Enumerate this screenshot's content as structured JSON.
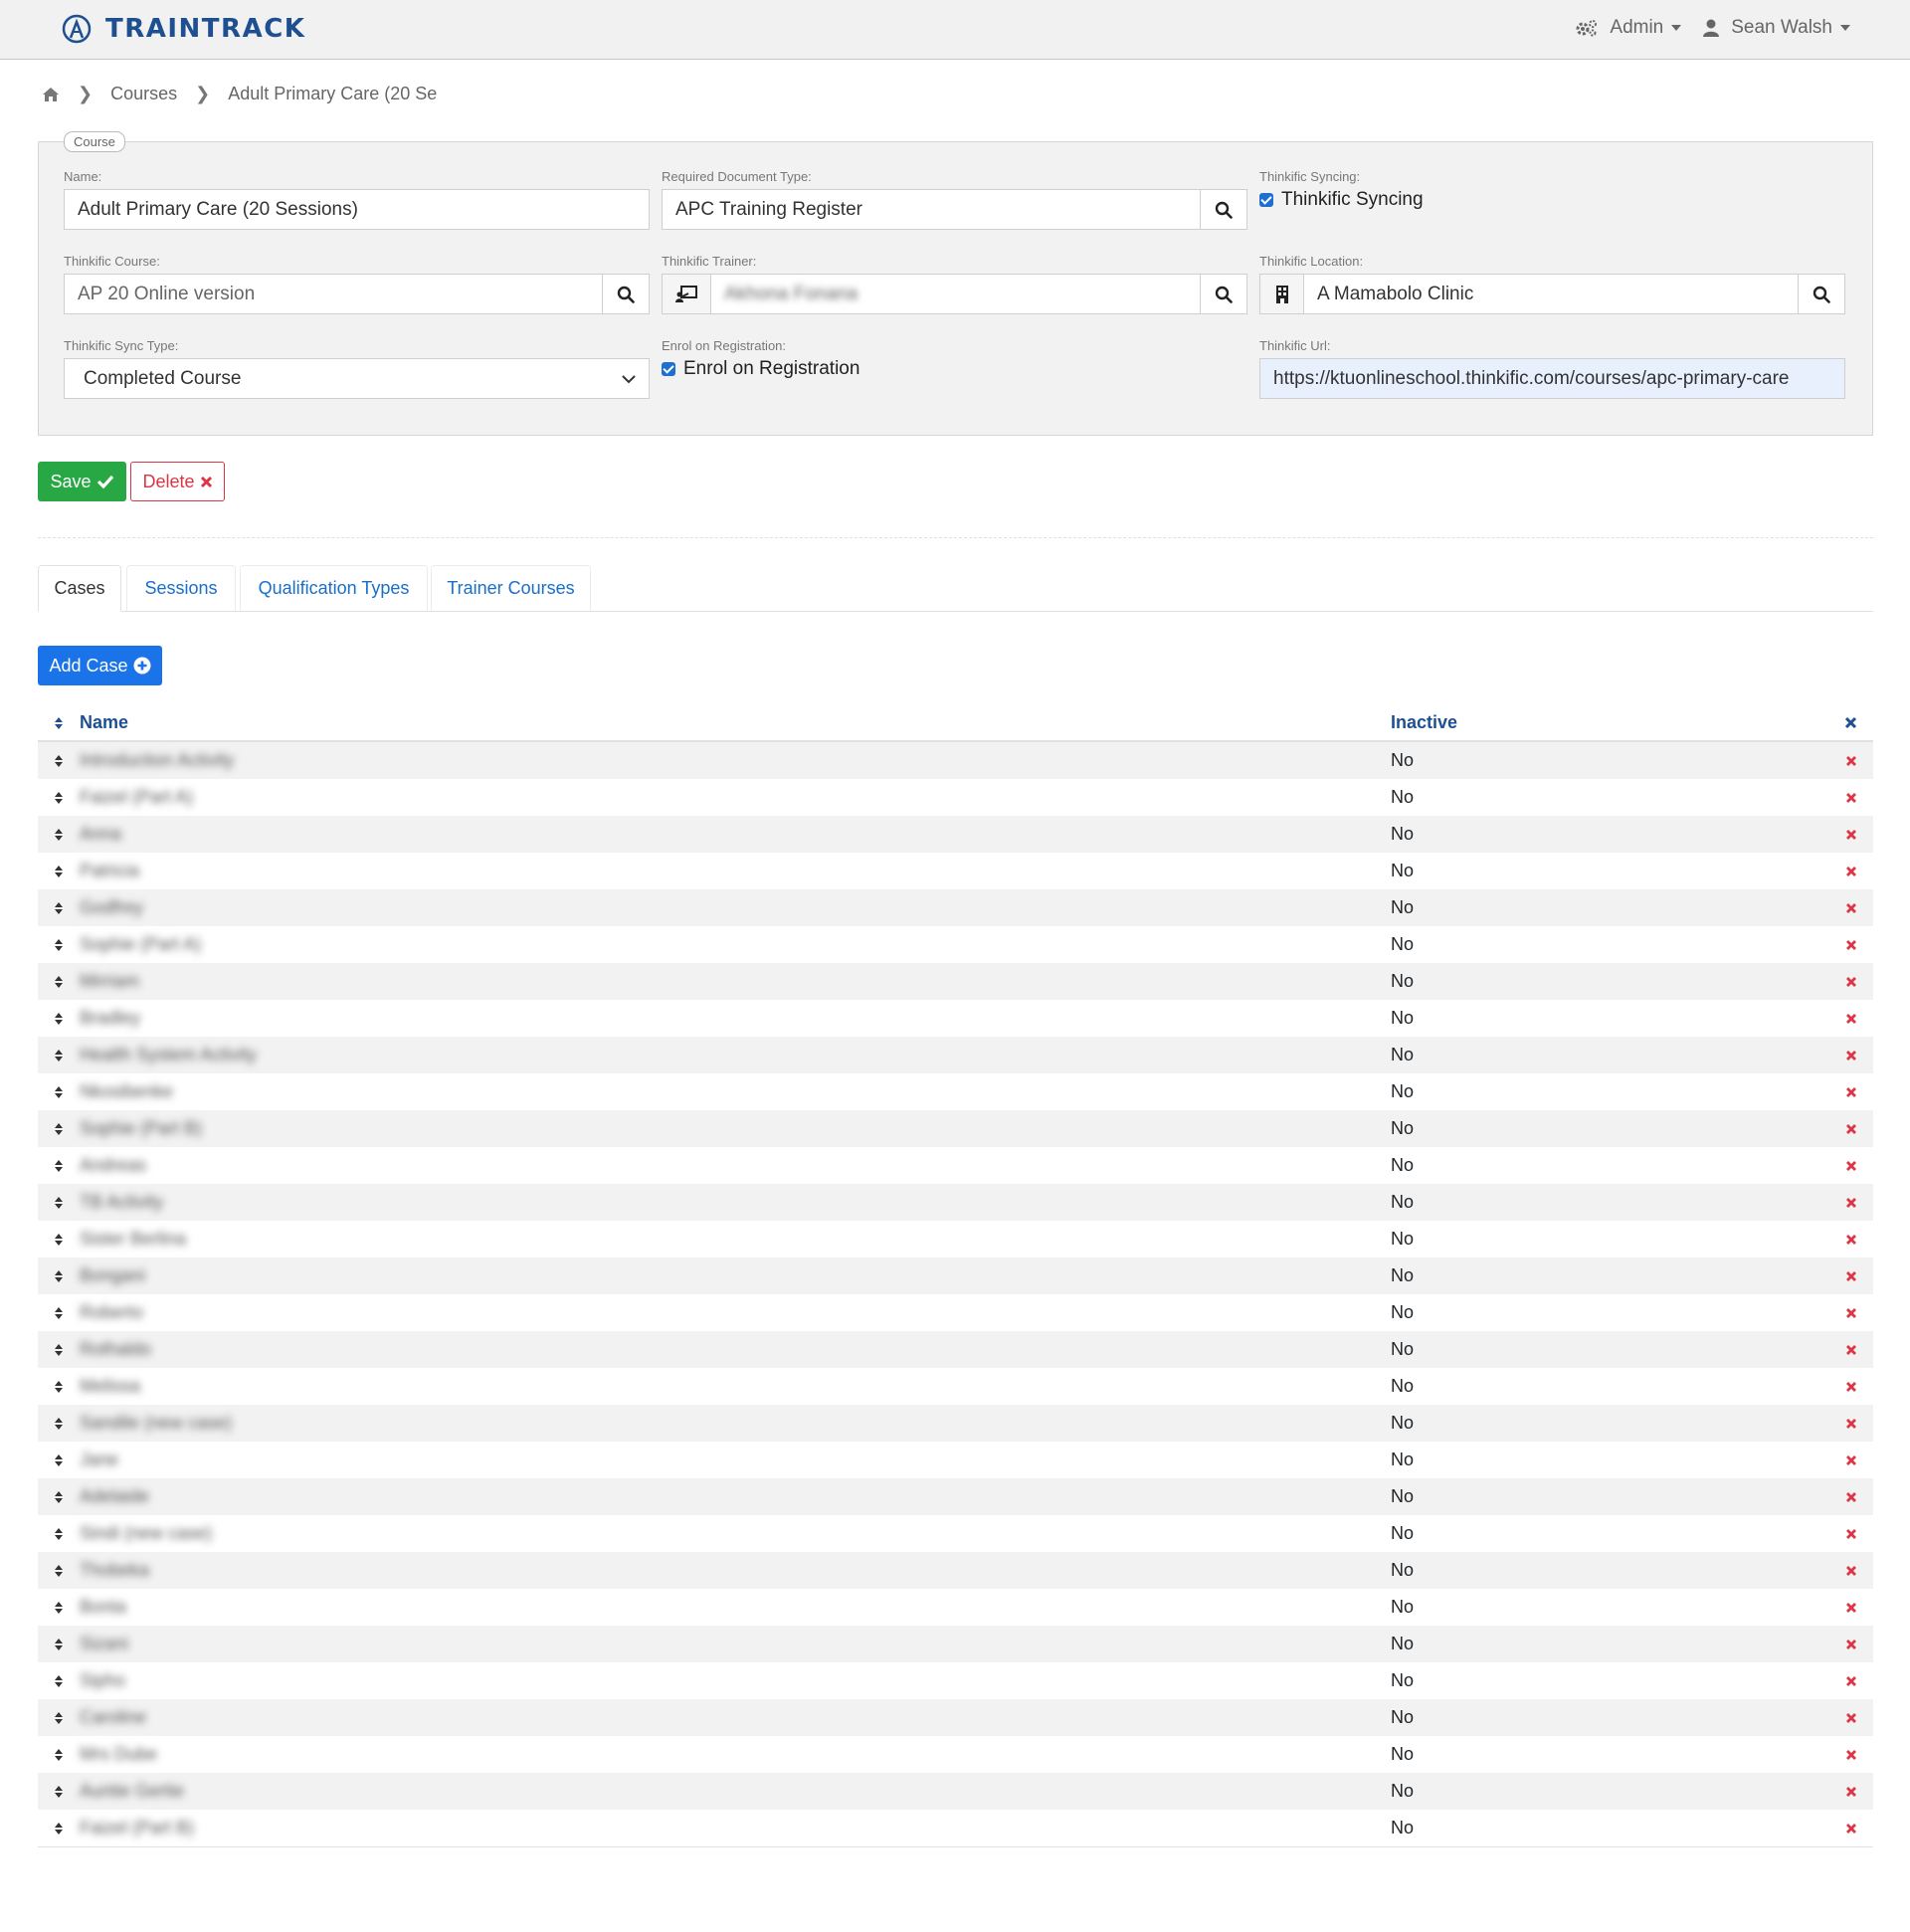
{
  "app": {
    "brand": "TRAINTRACK",
    "nav": {
      "admin_label": "Admin",
      "user_label": "Sean Walsh"
    }
  },
  "breadcrumb": {
    "courses": "Courses",
    "current": "Adult Primary Care (20 Se"
  },
  "course": {
    "legend": "Course",
    "name": {
      "label": "Name:",
      "value": "Adult Primary Care (20 Sessions)"
    },
    "required_document_type": {
      "label": "Required Document Type:",
      "value": "APC Training Register"
    },
    "thinkific_syncing": {
      "label": "Thinkific Syncing:",
      "checkbox_label": "Thinkific Syncing",
      "checked": true
    },
    "thinkific_course": {
      "label": "Thinkific Course:",
      "value": "AP 20 Online version"
    },
    "thinkific_trainer": {
      "label": "Thinkific Trainer:",
      "value": "Akhona Fonana"
    },
    "thinkific_location": {
      "label": "Thinkific Location:",
      "value": "A Mamabolo Clinic"
    },
    "thinkific_sync_type": {
      "label": "Thinkific Sync Type:",
      "value": "Completed Course"
    },
    "enrol_on_registration": {
      "label": "Enrol on Registration:",
      "checkbox_label": "Enrol on Registration",
      "checked": true
    },
    "thinkific_url": {
      "label": "Thinkific Url:",
      "value": "https://ktuonlineschool.thinkific.com/courses/apc-primary-care"
    }
  },
  "actions": {
    "save": "Save",
    "delete": "Delete",
    "add_case": "Add Case"
  },
  "tabs": [
    "Cases",
    "Sessions",
    "Qualification Types",
    "Trainer Courses"
  ],
  "table": {
    "headers": {
      "name": "Name",
      "inactive": "Inactive"
    },
    "rows": [
      {
        "name": "Introduction Activity",
        "inactive": "No"
      },
      {
        "name": "Faizel (Part A)",
        "inactive": "No"
      },
      {
        "name": "Anna",
        "inactive": "No"
      },
      {
        "name": "Patricia",
        "inactive": "No"
      },
      {
        "name": "Godfrey",
        "inactive": "No"
      },
      {
        "name": "Sophie (Part A)",
        "inactive": "No"
      },
      {
        "name": "Mirriam",
        "inactive": "No"
      },
      {
        "name": "Bradley",
        "inactive": "No"
      },
      {
        "name": "Health System Activity",
        "inactive": "No"
      },
      {
        "name": "Nkosibenke",
        "inactive": "No"
      },
      {
        "name": "Sophie (Part B)",
        "inactive": "No"
      },
      {
        "name": "Andreas",
        "inactive": "No"
      },
      {
        "name": "TB Activity",
        "inactive": "No"
      },
      {
        "name": "Sister Berlina",
        "inactive": "No"
      },
      {
        "name": "Bongani",
        "inactive": "No"
      },
      {
        "name": "Roberto",
        "inactive": "No"
      },
      {
        "name": "Rothaldo",
        "inactive": "No"
      },
      {
        "name": "Melissa",
        "inactive": "No"
      },
      {
        "name": "Sandile (new case)",
        "inactive": "No"
      },
      {
        "name": "Jane",
        "inactive": "No"
      },
      {
        "name": "Adelaide",
        "inactive": "No"
      },
      {
        "name": "Sindi (new case)",
        "inactive": "No"
      },
      {
        "name": "Thobeka",
        "inactive": "No"
      },
      {
        "name": "Bonta",
        "inactive": "No"
      },
      {
        "name": "Sizani",
        "inactive": "No"
      },
      {
        "name": "Sipho",
        "inactive": "No"
      },
      {
        "name": "Caroline",
        "inactive": "No"
      },
      {
        "name": "Mrs Dube",
        "inactive": "No"
      },
      {
        "name": "Auntie Gertie",
        "inactive": "No"
      },
      {
        "name": "Faizel (Part B)",
        "inactive": "No"
      }
    ]
  },
  "colors": {
    "brand": "#1d4f91",
    "save": "#28a745",
    "delete": "#dc3545",
    "primary": "#1a73e8",
    "link": "#1a6fc9"
  },
  "icons": [
    "logo-icon",
    "gear-icon",
    "user-icon",
    "home-icon",
    "search-icon",
    "trainer-icon",
    "building-icon",
    "check-icon",
    "close-icon",
    "plus-circle-icon",
    "sort-icon",
    "delete-x-icon"
  ]
}
